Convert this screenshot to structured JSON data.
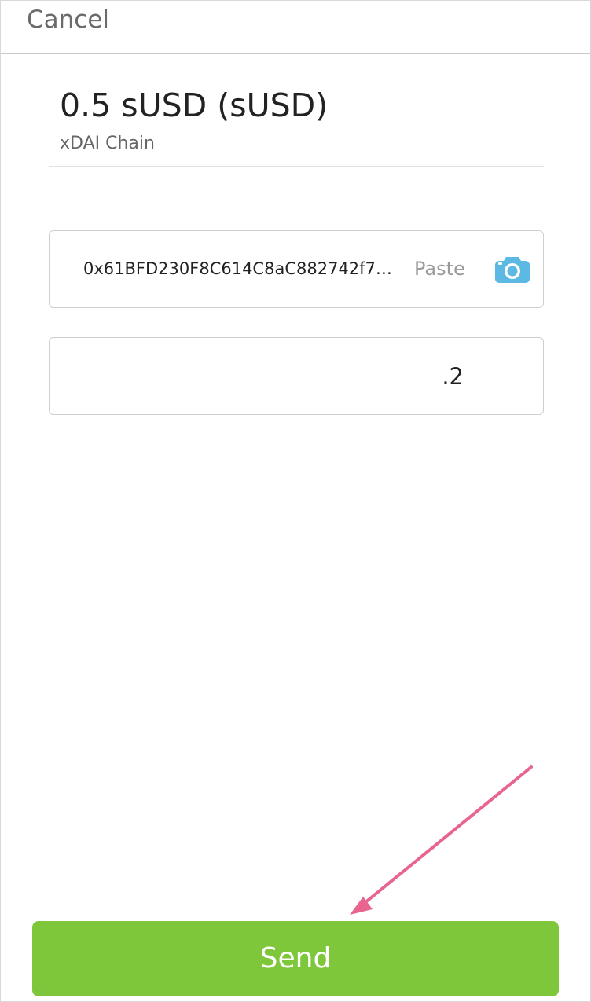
{
  "header": {
    "cancel_label": "Cancel"
  },
  "token": {
    "title": "0.5 sUSD (sUSD)",
    "chain": "xDAI Chain"
  },
  "address_field": {
    "value": "0x61BFD230F8C614C8aC882742f7…",
    "paste_label": "Paste",
    "camera_icon": "camera-icon",
    "camera_color": "#5bb9e3"
  },
  "amount_field": {
    "value": ".2"
  },
  "send_button": {
    "label": "Send",
    "color": "#7ec63a"
  },
  "annotation": {
    "arrow_color": "#e8658f"
  }
}
